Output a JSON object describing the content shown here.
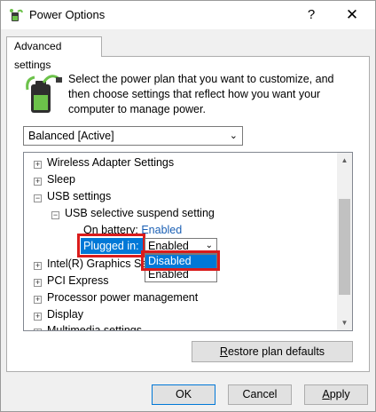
{
  "window": {
    "title": "Power Options",
    "help_glyph": "?",
    "close_glyph": "✕"
  },
  "tab": {
    "label": "Advanced settings"
  },
  "description": "Select the power plan that you want to customize, and then choose settings that reflect how you want your computer to manage power.",
  "plan": {
    "selected": "Balanced [Active]"
  },
  "tree": {
    "items": [
      {
        "label": "Wireless Adapter Settings",
        "expander": "+"
      },
      {
        "label": "Sleep",
        "expander": "+"
      },
      {
        "label": "USB settings",
        "expander": "−"
      },
      {
        "label": "USB selective suspend setting",
        "expander": "−"
      },
      {
        "label": "On battery:",
        "value": "Enabled"
      },
      {
        "label": "Plugged in:",
        "value": "Enabled"
      },
      {
        "label": "Intel(R) Graphics Se",
        "expander": "+"
      },
      {
        "label": "PCI Express",
        "expander": "+"
      },
      {
        "label": "Processor power management",
        "expander": "+"
      },
      {
        "label": "Display",
        "expander": "+"
      },
      {
        "label": "Multimedia settings",
        "expander": "+"
      }
    ]
  },
  "dropdown": {
    "options": [
      "Disabled",
      "Enabled"
    ],
    "highlighted": "Disabled"
  },
  "buttons": {
    "restore_prefix": "R",
    "restore_rest": "estore plan defaults",
    "ok": "OK",
    "cancel": "Cancel",
    "apply_prefix": "A",
    "apply_rest": "pply"
  },
  "colors": {
    "accent": "#0078d7",
    "annotation_red": "#d91c1c",
    "link": "#1a5fb4"
  }
}
